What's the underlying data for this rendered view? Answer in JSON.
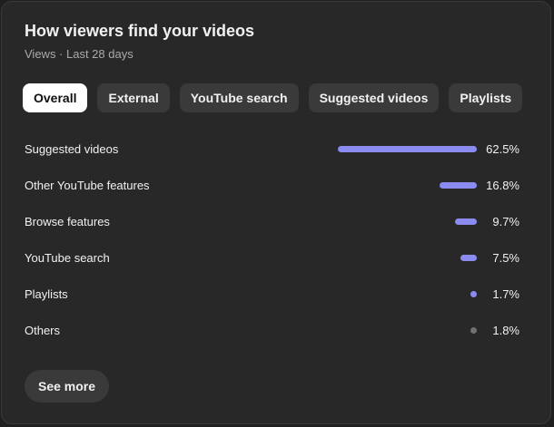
{
  "card": {
    "title": "How viewers find your videos",
    "subtitle": "Views · Last 28 days"
  },
  "tabs": [
    {
      "label": "Overall",
      "active": true
    },
    {
      "label": "External",
      "active": false
    },
    {
      "label": "YouTube search",
      "active": false
    },
    {
      "label": "Suggested videos",
      "active": false
    },
    {
      "label": "Playlists",
      "active": false
    }
  ],
  "sources": [
    {
      "label": "Suggested videos",
      "percent_text": "62.5%",
      "percent": 62.5,
      "color": "#8b8bf0"
    },
    {
      "label": "Other YouTube features",
      "percent_text": "16.8%",
      "percent": 16.8,
      "color": "#8b8bf0"
    },
    {
      "label": "Browse features",
      "percent_text": "9.7%",
      "percent": 9.7,
      "color": "#8b8bf0"
    },
    {
      "label": "YouTube search",
      "percent_text": "7.5%",
      "percent": 7.5,
      "color": "#8b8bf0"
    },
    {
      "label": "Playlists",
      "percent_text": "1.7%",
      "percent": 1.7,
      "color": "#8b8bf0"
    },
    {
      "label": "Others",
      "percent_text": "1.8%",
      "percent": 1.8,
      "color": "#717171"
    }
  ],
  "see_more_label": "See more"
}
